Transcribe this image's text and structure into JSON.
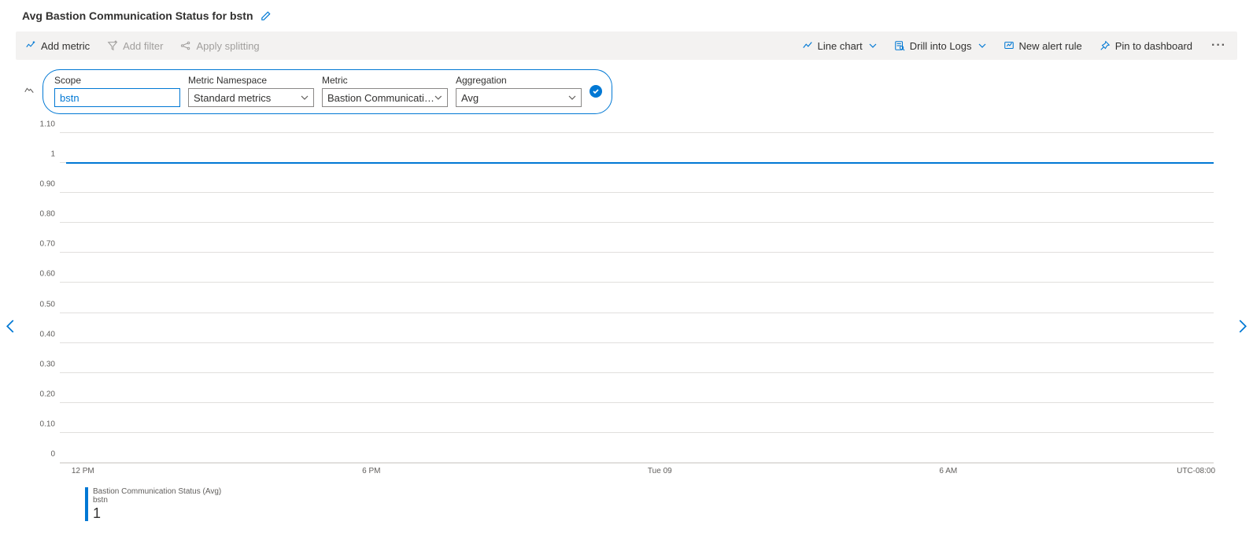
{
  "title": "Avg Bastion Communication Status for bstn",
  "toolbar": {
    "left": {
      "add_metric": "Add metric",
      "add_filter": "Add filter",
      "apply_splitting": "Apply splitting"
    },
    "right": {
      "chart_type": "Line chart",
      "drill_logs": "Drill into Logs",
      "new_alert": "New alert rule",
      "pin_dashboard": "Pin to dashboard"
    }
  },
  "pill": {
    "scope_label": "Scope",
    "scope_value": "bstn",
    "ns_label": "Metric Namespace",
    "ns_value": "Standard metrics",
    "metric_label": "Metric",
    "metric_value": "Bastion Communicatio...",
    "agg_label": "Aggregation",
    "agg_value": "Avg"
  },
  "chart_data": {
    "type": "line",
    "series": [
      {
        "name": "Bastion Communication Status (Avg)",
        "sub": "bstn",
        "color": "#0078d4",
        "values_constant": 1
      }
    ],
    "ylim": [
      0,
      1.1
    ],
    "y_ticks": [
      "0",
      "0.10",
      "0.20",
      "0.30",
      "0.40",
      "0.50",
      "0.60",
      "0.70",
      "0.80",
      "0.90",
      "1",
      "1.10"
    ],
    "x_ticks": [
      "12 PM",
      "6 PM",
      "Tue 09",
      "6 AM"
    ],
    "timezone_label": "UTC-08:00"
  },
  "legend": {
    "name": "Bastion Communication Status (Avg)",
    "sub": "bstn",
    "value": "1"
  }
}
